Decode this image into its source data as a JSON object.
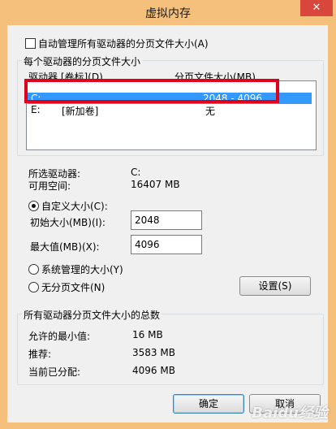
{
  "window": {
    "title": "虚拟内存",
    "close_glyph": "✕"
  },
  "auto_manage": {
    "label": "自动管理所有驱动器的分页文件大小(A)"
  },
  "drives_group": {
    "legend": "每个驱动器的分页文件大小",
    "col_drive": "驱动器 [卷标](D)",
    "col_size": "分页文件大小(MB)",
    "rows": [
      {
        "drive": "C:",
        "label": "",
        "size": "2048 - 4096"
      },
      {
        "drive": "E:",
        "label": "[新加卷]",
        "size": "无"
      }
    ]
  },
  "selected_drive": {
    "label": "所选驱动器:",
    "value": "C:",
    "space_label": "可用空间:",
    "space_value": "16407 MB"
  },
  "custom_size": {
    "radio_label": "自定义大小(C):",
    "initial_label": "初始大小(MB)(I):",
    "initial_value": "2048",
    "max_label": "最大值(MB)(X):",
    "max_value": "4096"
  },
  "system_managed": {
    "label": "系统管理的大小(Y)"
  },
  "no_paging": {
    "label": "无分页文件(N)"
  },
  "set_button": "设置(S)",
  "totals_group": {
    "legend": "所有驱动器分页文件大小的总数",
    "min_label": "允许的最小值:",
    "min_value": "16 MB",
    "recommended_label": "推荐:",
    "recommended_value": "3583 MB",
    "allocated_label": "当前已分配:",
    "allocated_value": "4096 MB"
  },
  "ok_button": "确定",
  "cancel_button": "取消",
  "watermark": "Baidu经验",
  "colors": {
    "accent_selected": "#3399ff",
    "highlight_box": "#e0001b",
    "frame": "#f5c07c"
  }
}
